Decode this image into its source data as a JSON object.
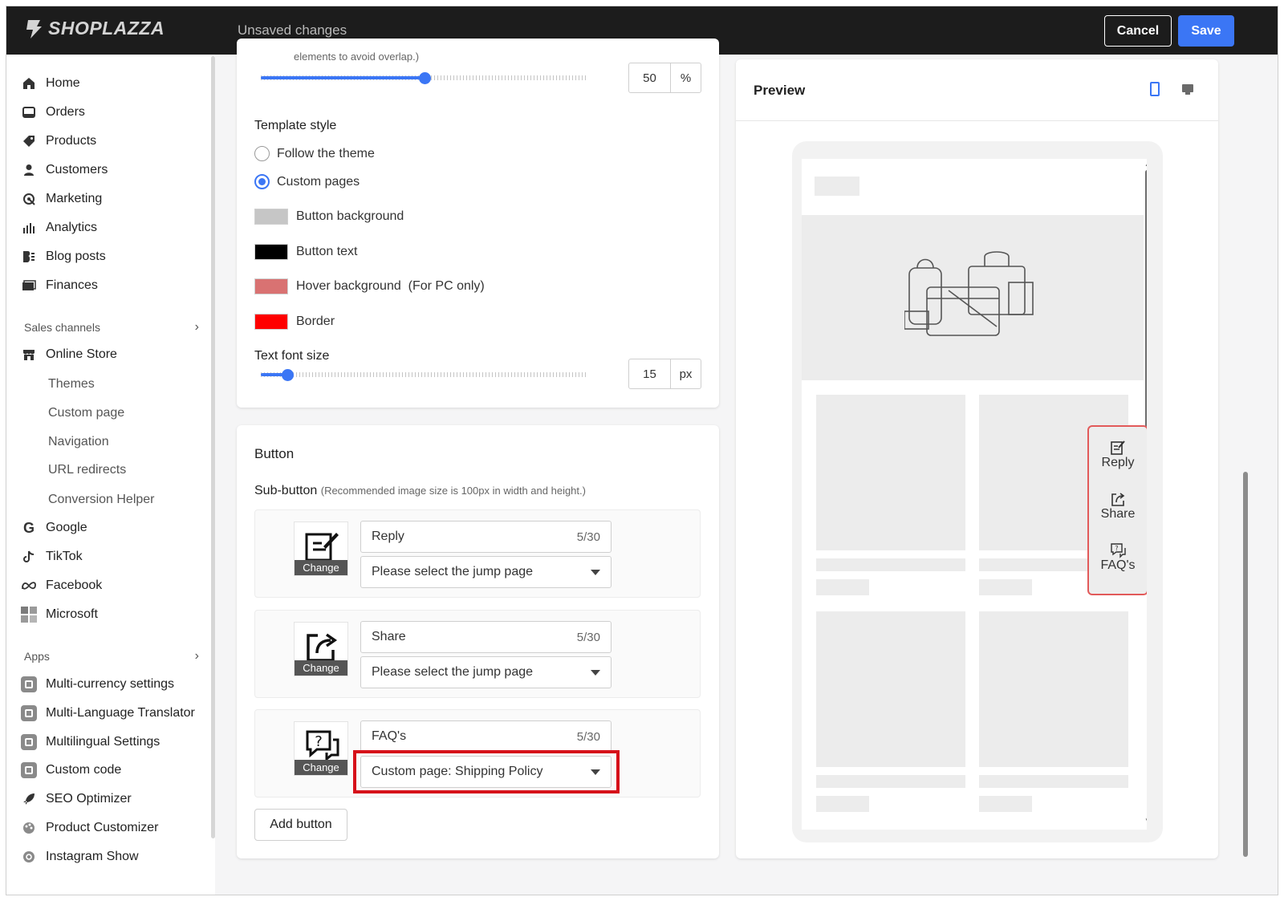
{
  "topbar": {
    "brand": "SHOPLAZZA",
    "status": "Unsaved changes",
    "cancel_label": "Cancel",
    "save_label": "Save"
  },
  "sidebar": {
    "main_items": [
      {
        "label": "Home",
        "icon": "home-icon"
      },
      {
        "label": "Orders",
        "icon": "orders-icon"
      },
      {
        "label": "Products",
        "icon": "tag-icon"
      },
      {
        "label": "Customers",
        "icon": "person-icon"
      },
      {
        "label": "Marketing",
        "icon": "megaphone-icon"
      },
      {
        "label": "Analytics",
        "icon": "bar-chart-icon"
      },
      {
        "label": "Blog posts",
        "icon": "blog-icon"
      },
      {
        "label": "Finances",
        "icon": "finance-icon"
      }
    ],
    "sales_channels_label": "Sales channels",
    "online_store_label": "Online Store",
    "online_store_sub": [
      "Themes",
      "Custom page",
      "Navigation",
      "URL redirects",
      "Conversion Helper"
    ],
    "channels": [
      {
        "label": "Google",
        "icon": "google-icon"
      },
      {
        "label": "TikTok",
        "icon": "tiktok-icon"
      },
      {
        "label": "Facebook",
        "icon": "meta-icon"
      },
      {
        "label": "Microsoft",
        "icon": "microsoft-icon"
      }
    ],
    "apps_label": "Apps",
    "apps": [
      "Multi-currency settings",
      "Multi-Language Translator",
      "Multilingual Settings",
      "Custom code",
      "SEO Optimizer",
      "Product Customizer",
      "Instagram Show"
    ]
  },
  "settings": {
    "partial_hint": "elements to avoid overlap.)",
    "position_value": "50",
    "position_unit": "%",
    "position_fraction": 0.5,
    "template_style_label": "Template style",
    "template_options": [
      "Follow the theme",
      "Custom pages"
    ],
    "template_selected": "Custom pages",
    "colors": [
      {
        "label": "Button background",
        "color": "#c6c6c6"
      },
      {
        "label": "Button text",
        "color": "#000000"
      },
      {
        "label": "Hover background  (For PC only)",
        "color": "#d97272"
      },
      {
        "label": "Border",
        "color": "#ff0000"
      }
    ],
    "font_size_label": "Text font size",
    "font_size_value": "15",
    "font_size_unit": "px",
    "font_size_fraction": 0.08
  },
  "button_panel": {
    "title": "Button",
    "sub_button_label": "Sub-button",
    "sub_button_hint": "(Recommended image size is 100px in width and height.)",
    "change_label": "Change",
    "sub_buttons": [
      {
        "name": "Reply",
        "count": "5/30",
        "page": "Please select the jump page",
        "icon": "reply-icon"
      },
      {
        "name": "Share",
        "count": "5/30",
        "page": "Please select the jump page",
        "icon": "share-icon"
      },
      {
        "name": "FAQ's",
        "count": "5/30",
        "page": "Custom page: Shipping Policy",
        "icon": "faq-icon"
      }
    ],
    "add_button_label": "Add button"
  },
  "preview": {
    "title": "Preview",
    "floating_items": [
      "Reply",
      "Share",
      "FAQ's"
    ]
  }
}
